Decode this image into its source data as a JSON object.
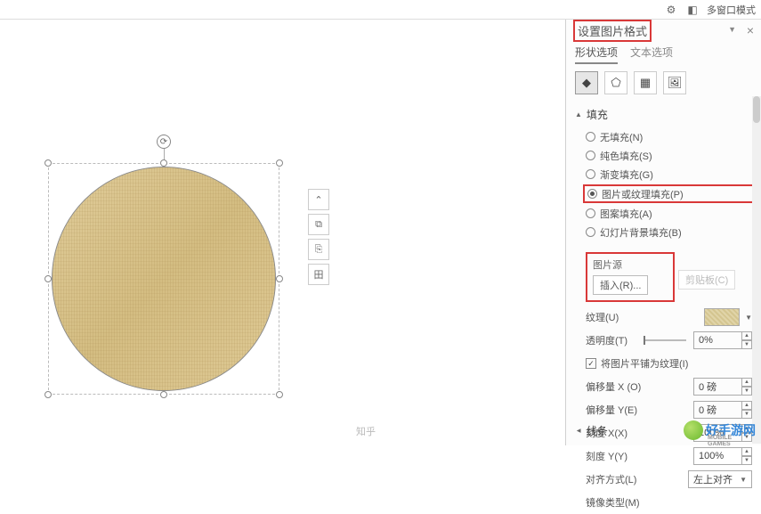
{
  "top": {
    "mode": "多窗口模式"
  },
  "pane": {
    "title": "设置图片格式",
    "tabs": {
      "shape": "形状选项",
      "text": "文本选项"
    }
  },
  "section_fill": "填充",
  "fill": {
    "none": "无填充(N)",
    "solid": "纯色填充(S)",
    "gradient": "渐变填充(G)",
    "picture": "图片或纹理填充(P)",
    "pattern": "图案填充(A)",
    "slidebg": "幻灯片背景填充(B)"
  },
  "picsrc": {
    "group": "图片源",
    "insert": "插入(R)...",
    "clipboard": "剪贴板(C)"
  },
  "texture_label": "纹理(U)",
  "transparency": {
    "label": "透明度(T)",
    "value": "0%"
  },
  "tile": {
    "label": "将图片平铺为纹理(I)"
  },
  "offx": {
    "label": "偏移量 X (O)",
    "value": "0 磅"
  },
  "offy": {
    "label": "偏移量 Y(E)",
    "value": "0 磅"
  },
  "scalex": {
    "label": "刻度 X(X)",
    "value": "100%"
  },
  "scaley": {
    "label": "刻度 Y(Y)",
    "value": "100%"
  },
  "align": {
    "label": "对齐方式(L)",
    "value": "左上对齐"
  },
  "mirror": {
    "label": "镜像类型(M)"
  },
  "section_line": "线条",
  "watermark1": "知乎",
  "watermark2": "好手游网"
}
